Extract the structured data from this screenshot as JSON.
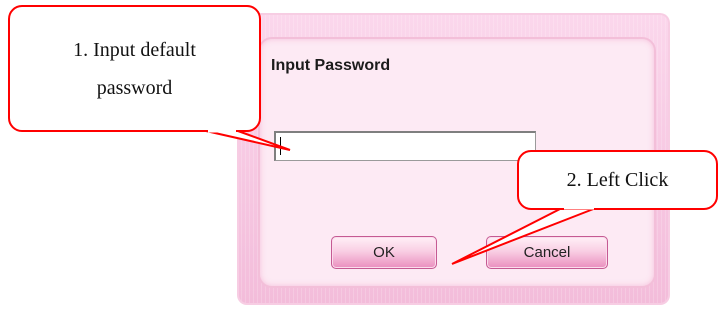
{
  "dialog": {
    "title": "Input Password",
    "password_value": "",
    "ok_label": "OK",
    "cancel_label": "Cancel"
  },
  "callouts": [
    {
      "line1": "1. Input default",
      "line2": "password"
    },
    {
      "text": "2. Left Click"
    }
  ],
  "colors": {
    "callout_border": "#ff0000",
    "dialog_pink": "#fbd7ec",
    "button_pink": "#ea8fbe"
  }
}
